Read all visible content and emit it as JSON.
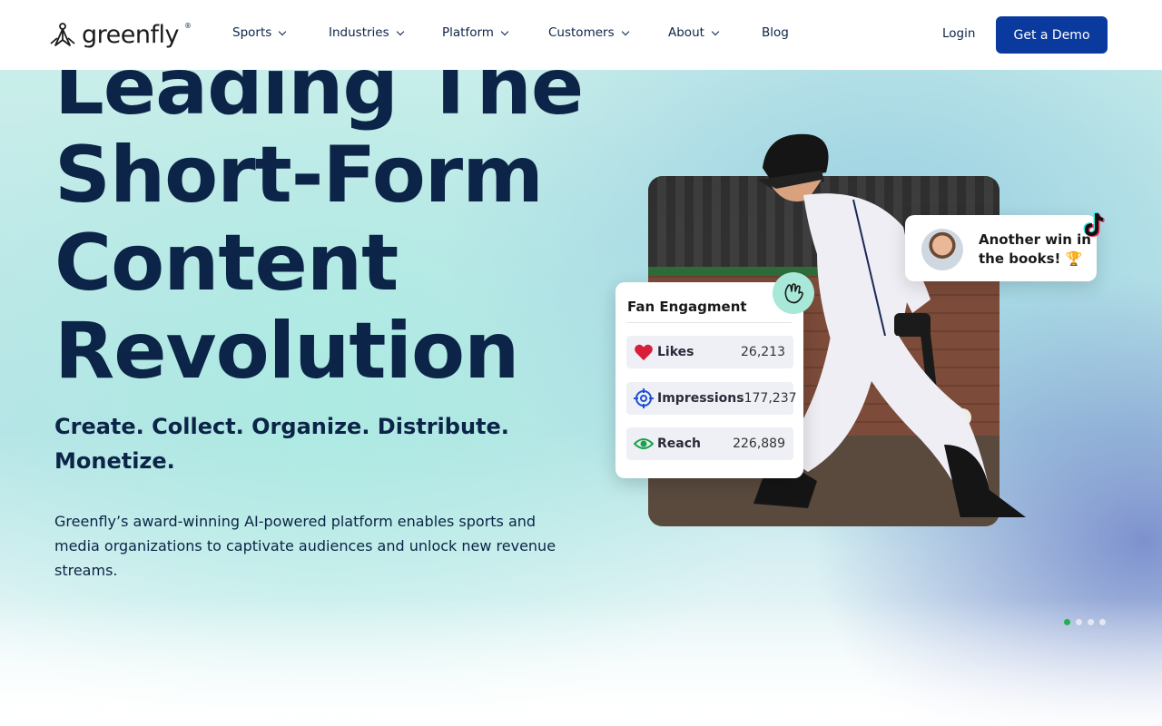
{
  "brand": {
    "name": "greenfly",
    "reg_mark": "®",
    "logo_icon": "fly-icon"
  },
  "nav": {
    "items": [
      {
        "label": "Sports",
        "has_dropdown": true
      },
      {
        "label": "Industries",
        "has_dropdown": true
      },
      {
        "label": "Platform",
        "has_dropdown": true
      },
      {
        "label": "Customers",
        "has_dropdown": true
      },
      {
        "label": "About",
        "has_dropdown": true
      },
      {
        "label": "Blog",
        "has_dropdown": false
      }
    ],
    "login": "Login",
    "cta": "Get a Demo"
  },
  "hero": {
    "headline_lines": [
      "Leading The",
      "Short-Form",
      "Content",
      "Revolution"
    ],
    "subheadline": "Create. Collect. Organize. Distribute. Monetize.",
    "description": "Greenfly’s award-winning AI-powered platform enables sports and media organizations to captivate audiences and unlock new revenue streams."
  },
  "engagement_card": {
    "title": "Fan Engagment",
    "metrics": [
      {
        "label": "Likes",
        "value": "26,213",
        "icon": "heart-icon",
        "color": "#d81f3a"
      },
      {
        "label": "Impressions",
        "value": "177,237",
        "icon": "target-icon",
        "color": "#1f4fd8"
      },
      {
        "label": "Reach",
        "value": "226,889",
        "icon": "eye-icon",
        "color": "#18a34a"
      }
    ]
  },
  "social_bubble": {
    "text": "Another win in the books! 🏆",
    "platform_icon": "tiktok-icon"
  },
  "carousel": {
    "slides": 4,
    "active": 0
  },
  "colors": {
    "primary": "#0a3a9e",
    "text": "#0b2447",
    "accent": "#22b24c"
  }
}
